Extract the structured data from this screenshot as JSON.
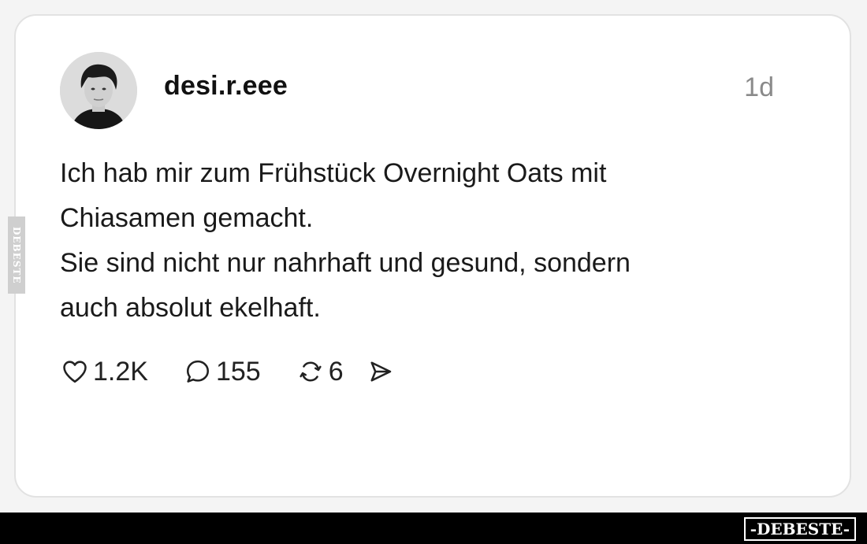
{
  "post": {
    "username": "desi.r.eee",
    "time": "1d",
    "text_lines": [
      "Ich hab mir zum Frühstück Overnight Oats mit",
      "Chiasamen gemacht.",
      "Sie sind nicht nur nahrhaft und gesund, sondern",
      "auch absolut ekelhaft."
    ]
  },
  "actions": {
    "likes": "1.2K",
    "replies": "155",
    "reposts": "6",
    "like_icon": "heart-icon",
    "reply_icon": "speech-bubble-icon",
    "repost_icon": "repost-arrows-icon",
    "share_icon": "send-icon"
  },
  "watermark": {
    "side": "DEBESTE",
    "footer": "-DEBESTE-"
  },
  "colors": {
    "card_background": "#ffffff",
    "page_background": "#f4f4f4",
    "timestamp": "#8a8a8a",
    "footer_bar": "#000000"
  }
}
